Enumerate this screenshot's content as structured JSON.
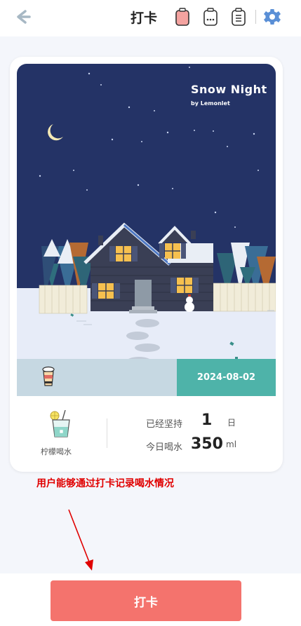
{
  "header": {
    "title": "打卡",
    "icons": [
      "back-arrow-icon",
      "cup-icon",
      "chat-bubble-icon",
      "clipboard-list-icon",
      "gear-icon"
    ]
  },
  "card": {
    "scene_title": "Snow Night",
    "scene_subtitle": "by Lemonlet",
    "date": "2024-08-02",
    "drink_name": "柠檬喝水",
    "streak_label": "已经坚持",
    "streak_value": "1",
    "streak_unit": "日",
    "today_label": "今日喝水",
    "today_value": "350",
    "today_unit": "ml"
  },
  "annotation": "用户能够通过打卡记录喝水情况",
  "checkin_button": "打卡",
  "colors": {
    "accent": "#4eb3a9",
    "button": "#f4736d",
    "sky": "#243366",
    "annotation": "#e00000"
  }
}
